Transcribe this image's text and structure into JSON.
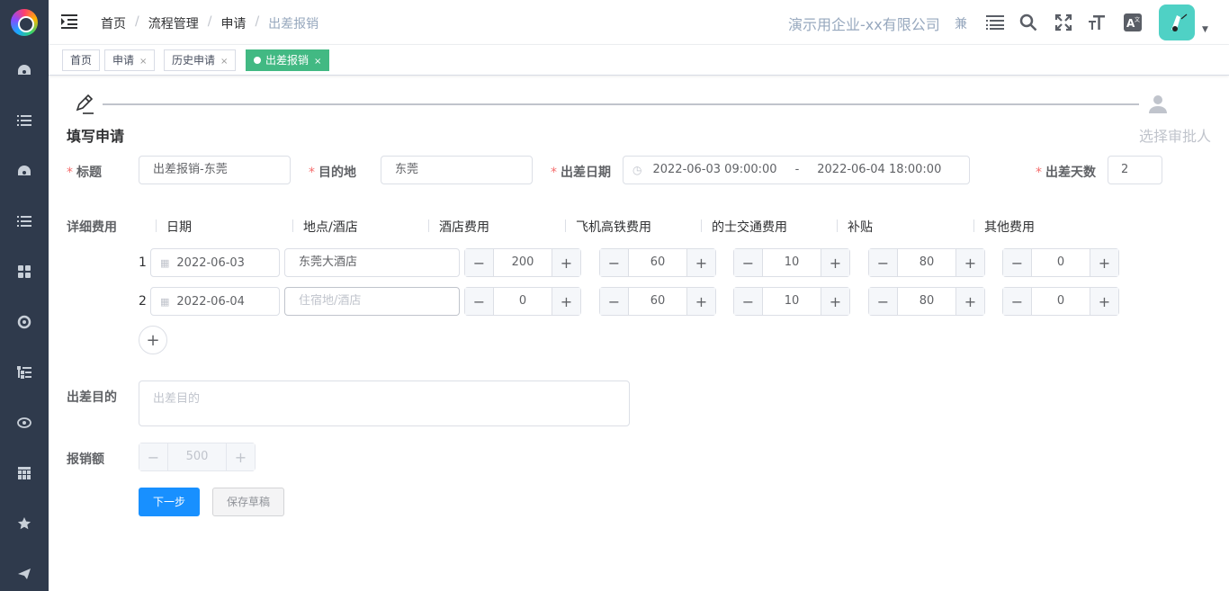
{
  "breadcrumb": [
    "首页",
    "流程管理",
    "申请",
    "出差报销"
  ],
  "header": {
    "company": "演示用企业-xx有限公司",
    "lang_short": "兼"
  },
  "tags": [
    {
      "label": "首页",
      "closable": false
    },
    {
      "label": "申请",
      "closable": true
    },
    {
      "label": "历史申请",
      "closable": true
    },
    {
      "label": "出差报销",
      "closable": true,
      "active": true
    }
  ],
  "steps": [
    {
      "title": "填写申请",
      "active": true
    },
    {
      "title": "选择审批人",
      "active": false
    }
  ],
  "form": {
    "title_label": "标题",
    "title_value": "出差报销-东莞",
    "dest_label": "目的地",
    "dest_value": "东莞",
    "date_label": "出差日期",
    "date_start": "2022-06-03 09:00:00",
    "date_sep": "-",
    "date_end": "2022-06-04 18:00:00",
    "days_label": "出差天数",
    "days_value": "2",
    "detail_label": "详细费用",
    "columns": [
      "日期",
      "地点/酒店",
      "酒店费用",
      "飞机高铁费用",
      "的士交通费用",
      "补贴",
      "其他费用"
    ],
    "rows": [
      {
        "num": "1",
        "date": "2022-06-03",
        "place": "东莞大酒店",
        "place_placeholder": "",
        "hotel": "200",
        "flight": "60",
        "taxi": "10",
        "subsidy": "80",
        "other": "0"
      },
      {
        "num": "2",
        "date": "2022-06-04",
        "place": "",
        "place_placeholder": "住宿地/酒店",
        "hotel": "0",
        "flight": "60",
        "taxi": "10",
        "subsidy": "80",
        "other": "0"
      }
    ],
    "purpose_label": "出差目的",
    "purpose_placeholder": "出差目的",
    "amount_label": "报销额",
    "amount_value": "500",
    "next_button": "下一步",
    "draft_button": "保存草稿"
  },
  "icons": {
    "sidebar": [
      "dashboard-icon",
      "list-icon",
      "dashboard-icon",
      "list-icon",
      "grid-icon",
      "target-icon",
      "tree-icon",
      "eye-icon",
      "table-icon",
      "star-icon",
      "send-icon"
    ],
    "header": [
      "fold-icon",
      "menu-icon",
      "search-icon",
      "fullscreen-icon",
      "text-size-icon",
      "translate-icon"
    ]
  },
  "colors": {
    "sidebar": "#2f3a4c",
    "tag_active": "#42b983",
    "primary": "#1890ff",
    "required": "#f56c6c"
  }
}
